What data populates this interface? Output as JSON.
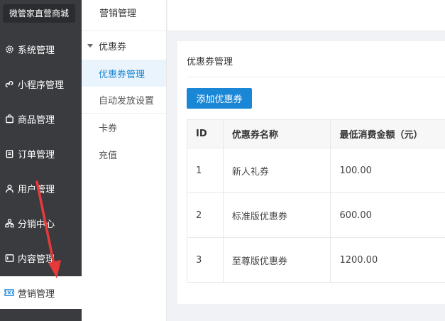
{
  "sidebar": {
    "brand": "微管家直营商城",
    "items": [
      {
        "label": "系统管理",
        "icon": "gear-icon"
      },
      {
        "label": "小程序管理",
        "icon": "mini-program-icon"
      },
      {
        "label": "商品管理",
        "icon": "bag-icon"
      },
      {
        "label": "订单管理",
        "icon": "order-icon"
      },
      {
        "label": "用户管理",
        "icon": "user-icon"
      },
      {
        "label": "分销中心",
        "icon": "network-icon"
      },
      {
        "label": "内容管理",
        "icon": "content-icon"
      },
      {
        "label": "营销管理",
        "icon": "ticket-icon"
      }
    ]
  },
  "submenu": {
    "header": "营销管理",
    "group": "优惠券",
    "items": [
      "优惠券管理",
      "自动发放设置",
      "卡券",
      "充值"
    ]
  },
  "main": {
    "card_title": "优惠券管理",
    "add_button": "添加优惠券",
    "table": {
      "columns": [
        "ID",
        "优惠券名称",
        "最低消费金额（元）"
      ],
      "rows": [
        [
          "1",
          "新人礼券",
          "100.00"
        ],
        [
          "2",
          "标准版优惠券",
          "600.00"
        ],
        [
          "3",
          "至尊版优惠券",
          "1200.00"
        ]
      ]
    }
  },
  "colors": {
    "sidebar_bg": "#3a3b3f",
    "accent": "#1a86d6",
    "arrow": "#e8393a"
  }
}
